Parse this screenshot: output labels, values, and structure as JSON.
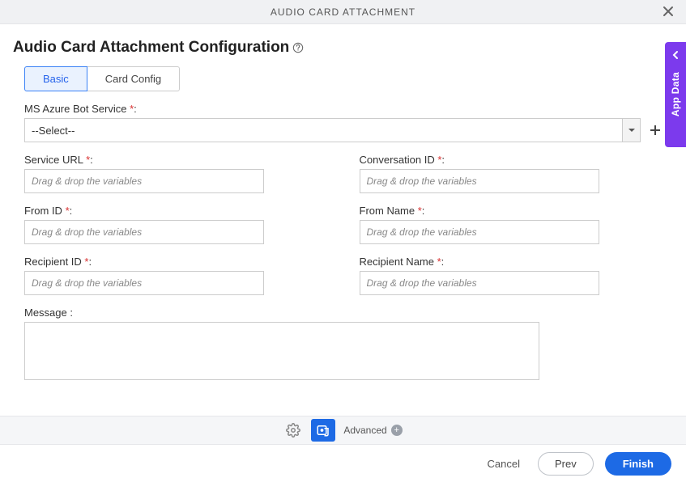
{
  "header": {
    "title": "AUDIO CARD ATTACHMENT"
  },
  "page": {
    "title": "Audio Card Attachment Configuration"
  },
  "tabs": [
    {
      "label": "Basic",
      "active": true
    },
    {
      "label": "Card Config",
      "active": false
    }
  ],
  "form": {
    "azure_label": "MS Azure Bot Service ",
    "azure_select_value": "--Select--",
    "service_url_label": "Service URL ",
    "conversation_id_label": "Conversation ID ",
    "from_id_label": "From ID ",
    "from_name_label": "From Name ",
    "recipient_id_label": "Recipient ID ",
    "recipient_name_label": "Recipient Name ",
    "message_label": "Message :",
    "placeholder": "Drag & drop the variables"
  },
  "toolbar": {
    "advanced_label": "Advanced"
  },
  "footer": {
    "cancel": "Cancel",
    "prev": "Prev",
    "finish": "Finish"
  },
  "side": {
    "label": "App Data"
  }
}
